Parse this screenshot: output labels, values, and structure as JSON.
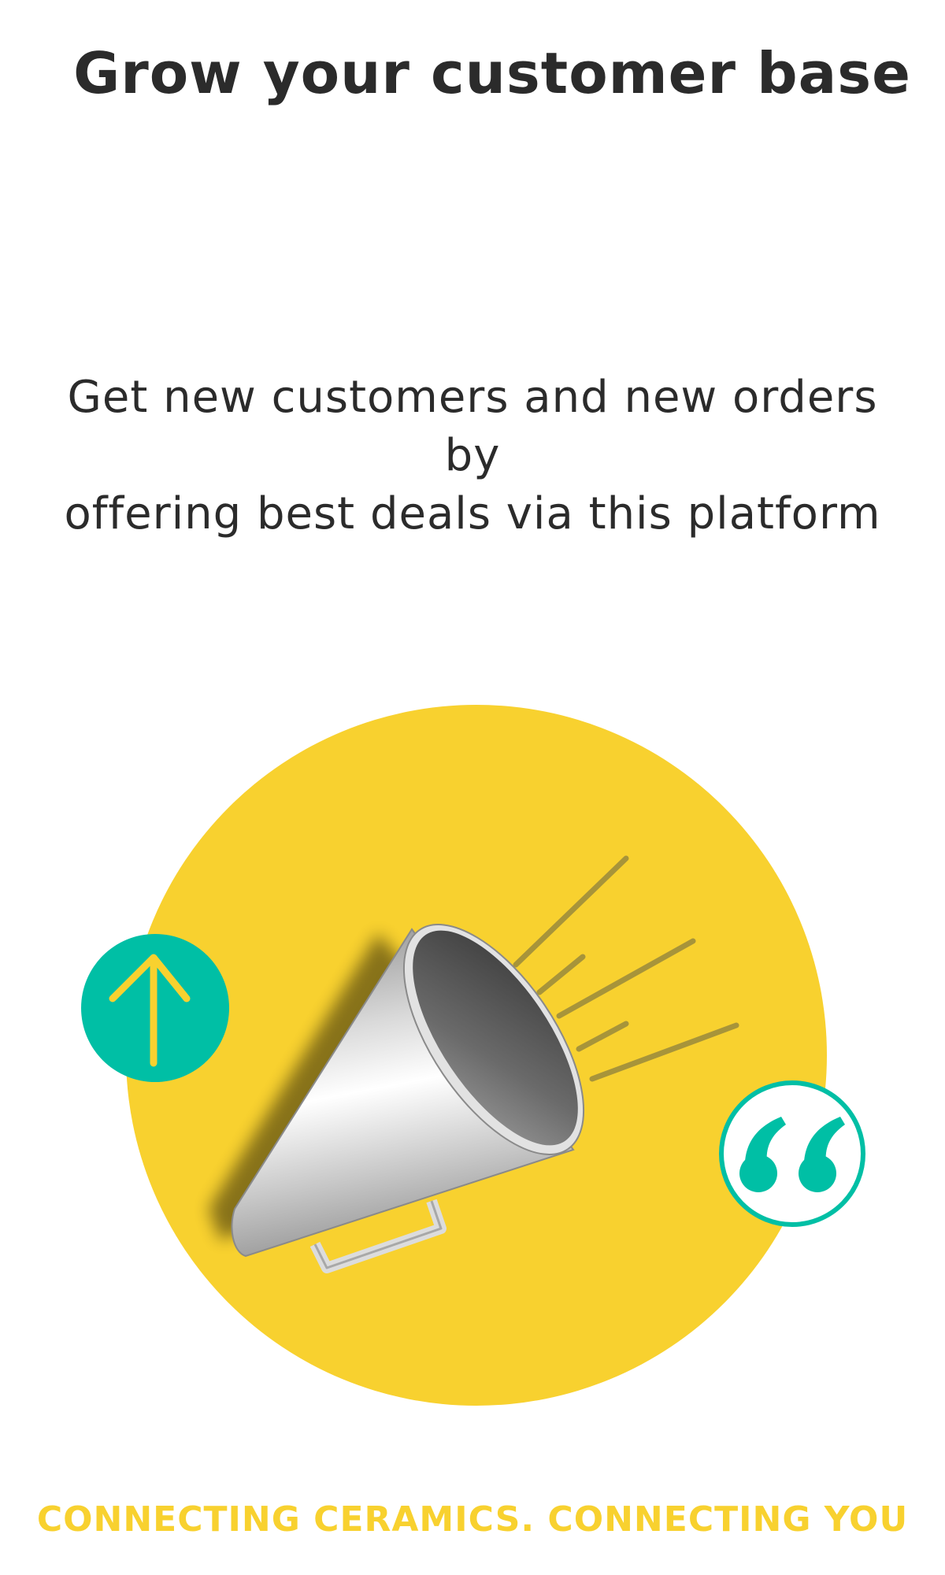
{
  "header": {
    "title": "Grow your customer base"
  },
  "body": {
    "subtitle_line1": "Get new customers and new orders by",
    "subtitle_line2": "offering best deals via this platform"
  },
  "illustration": {
    "circle_color": "#f8d12f",
    "accent_color": "#00bfa5",
    "icons": [
      "megaphone-icon",
      "arrow-up-icon",
      "quote-icon"
    ]
  },
  "footer": {
    "tagline": "CONNECTING CERAMICS. CONNECTING YOU"
  }
}
